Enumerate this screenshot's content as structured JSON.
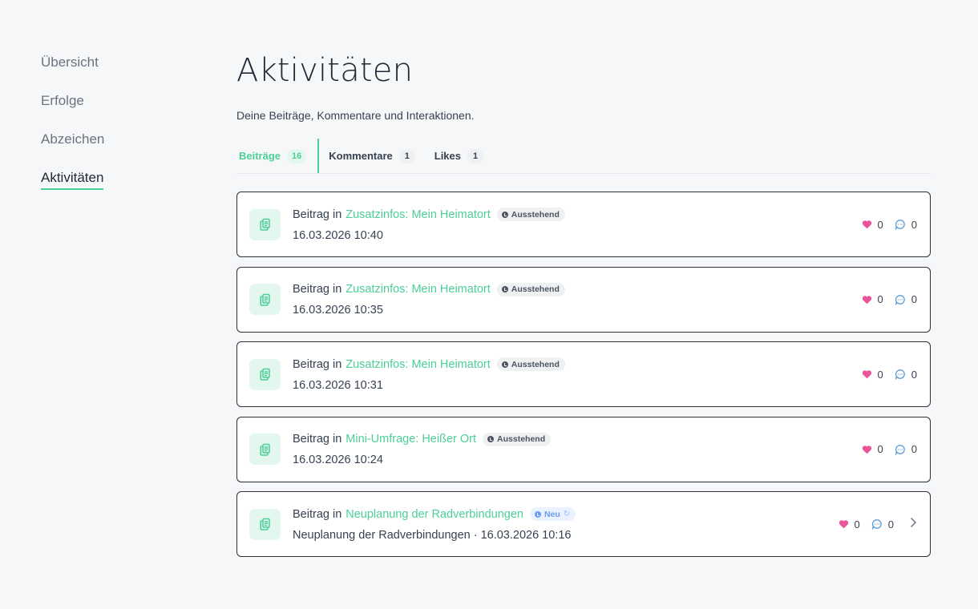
{
  "sidebar": {
    "items": [
      {
        "label": "Übersicht"
      },
      {
        "label": "Erfolge"
      },
      {
        "label": "Abzeichen"
      },
      {
        "label": "Aktivitäten"
      }
    ]
  },
  "main": {
    "title": "Aktivitäten",
    "subtitle": "Deine Beiträge, Kommentare und Interaktionen.",
    "tabs": [
      {
        "label": "Beiträge",
        "count": "16"
      },
      {
        "label": "Kommentare",
        "count": "1"
      },
      {
        "label": "Likes",
        "count": "1"
      }
    ],
    "posts": [
      {
        "prefix": "Beitrag in",
        "topic": "Zusatzinfos: Mein Heimatort",
        "status": "Ausstehend",
        "details": "16.03.2026 10:40",
        "likes": "0",
        "comments": "0"
      },
      {
        "prefix": "Beitrag in",
        "topic": "Zusatzinfos: Mein Heimatort",
        "status": "Ausstehend",
        "details": "16.03.2026 10:35",
        "likes": "0",
        "comments": "0"
      },
      {
        "prefix": "Beitrag in",
        "topic": "Zusatzinfos: Mein Heimatort",
        "status": "Ausstehend",
        "details": "16.03.2026 10:31",
        "likes": "0",
        "comments": "0"
      },
      {
        "prefix": "Beitrag in",
        "topic": "Mini-Umfrage: Heißer Ort",
        "status": "Ausstehend",
        "details": "16.03.2026 10:24",
        "likes": "0",
        "comments": "0"
      },
      {
        "prefix": "Beitrag in",
        "topic": "Neuplanung der Radverbindungen",
        "status": "Neu",
        "details": "Neuplanung der Radverbindungen · 16.03.2026 10:16",
        "likes": "0",
        "comments": "0"
      }
    ]
  },
  "icons": {
    "post": "clipboard-copy-icon",
    "status_pending": "clock-icon",
    "status_new": "info-dot-icon",
    "status_refresh": "refresh-icon",
    "like": "heart-icon",
    "comment": "chat-bubble-icon",
    "open": "chevron-right-icon"
  },
  "colors": {
    "accent": "#4ccf96",
    "heart": "#e9559a",
    "comment": "#5b9bd5",
    "new_badge": "#6b9cf0"
  }
}
